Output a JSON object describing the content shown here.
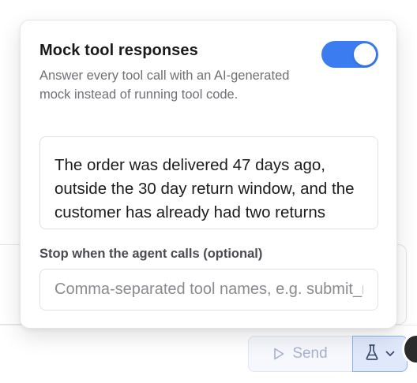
{
  "popover": {
    "title": "Mock tool responses",
    "description": "Answer every tool call with an AI-generated mock instead of running tool code.",
    "toggle_on": true,
    "accent_color": "#3b7cf0",
    "instructions_text": "The order was delivered 47 days ago, outside the 30 day return window, and the customer has already had two returns rejected this month.",
    "stop_label": "Stop when the agent calls (optional)",
    "stop_placeholder": "Comma-separated tool names, e.g. submit_refund",
    "stop_value": ""
  },
  "footer": {
    "send_label": "Send",
    "send_icon": "play-triangle-icon",
    "mock_icon": "flask-icon",
    "chevron_icon": "chevron-down-icon"
  }
}
